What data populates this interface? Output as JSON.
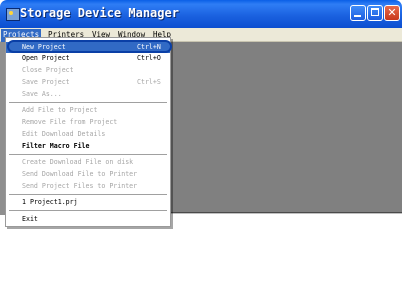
{
  "window": {
    "title": "Storage Device Manager",
    "min_label": "",
    "max_label": "",
    "close_label": "✕"
  },
  "menubar": {
    "items": [
      "Projects",
      "Printers",
      "View",
      "Window",
      "Help"
    ]
  },
  "projects_menu": {
    "items": [
      {
        "label": "New Project",
        "shortcut": "Ctrl+N",
        "state": "selected"
      },
      {
        "label": "Open Project",
        "shortcut": "Ctrl+O",
        "state": "enabled"
      },
      {
        "label": "Close Project",
        "shortcut": "",
        "state": "disabled"
      },
      {
        "label": "Save Project",
        "shortcut": "Ctrl+S",
        "state": "disabled"
      },
      {
        "label": "Save As...",
        "shortcut": "",
        "state": "disabled"
      },
      {
        "label": "Add File to Project",
        "shortcut": "",
        "state": "disabled"
      },
      {
        "label": "Remove File from Project",
        "shortcut": "",
        "state": "disabled"
      },
      {
        "label": "Edit Download Details",
        "shortcut": "",
        "state": "disabled"
      },
      {
        "label": "Filter Macro File",
        "shortcut": "",
        "state": "bold"
      },
      {
        "label": "Create Download File on disk",
        "shortcut": "",
        "state": "disabled"
      },
      {
        "label": "Send Download File to Printer",
        "shortcut": "",
        "state": "disabled"
      },
      {
        "label": "Send Project Files to Printer",
        "shortcut": "",
        "state": "disabled"
      },
      {
        "label": "1 Project1.prj",
        "shortcut": "",
        "state": "enabled"
      },
      {
        "label": "Exit",
        "shortcut": "",
        "state": "enabled"
      }
    ]
  },
  "colors": {
    "titlebar": "#0c4ed0",
    "menu_highlight": "#316ac5",
    "workspace": "#808080",
    "annotation_outline": "#0a3fa6"
  }
}
